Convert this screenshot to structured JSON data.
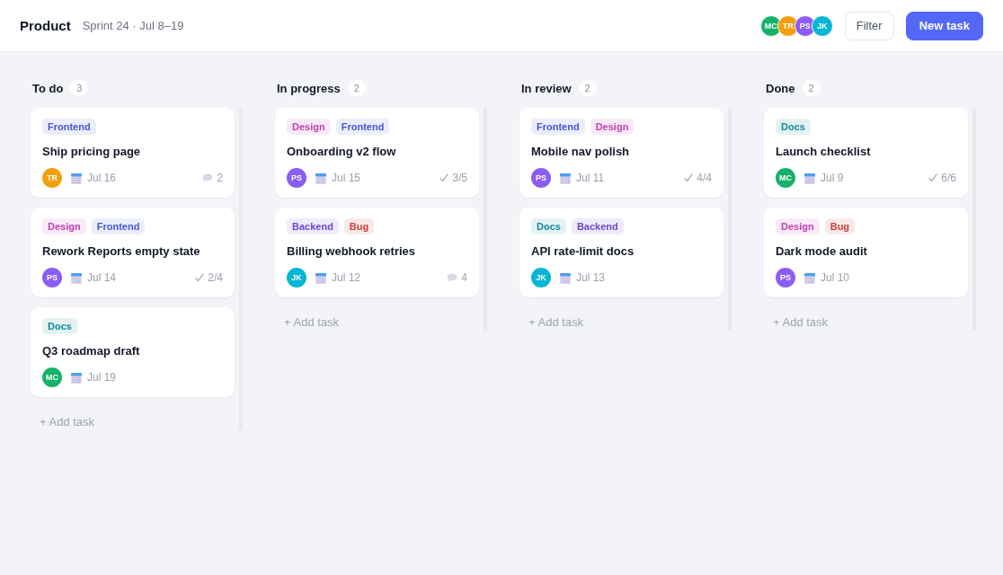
{
  "header": {
    "title": "Product",
    "subtitle": "Sprint 24 · Jul 8–19",
    "members": [
      {
        "initials": "MC",
        "color": "#17b26a"
      },
      {
        "initials": "TR",
        "color": "#f59e0b"
      },
      {
        "initials": "PS",
        "color": "#8b5cf6"
      },
      {
        "initials": "JK",
        "color": "#06b6d4"
      }
    ],
    "buttons": [
      {
        "label": "Filter",
        "kind": "secondary"
      },
      {
        "label": "New task",
        "kind": "primary"
      }
    ]
  },
  "columns": [
    {
      "title": "To do",
      "count": "3",
      "cards": [
        {
          "tags": [
            {
              "label": "Frontend",
              "color": "#4657d6"
            }
          ],
          "title": "Ship pricing page",
          "assignee": {
            "initials": "TR",
            "color": "#f59e0b"
          },
          "due": "Jul 16",
          "meta": {
            "kind": "comments",
            "text": "2"
          }
        },
        {
          "tags": [
            {
              "label": "Design",
              "color": "#c43fb4"
            },
            {
              "label": "Frontend",
              "color": "#4657d6"
            }
          ],
          "title": "Rework Reports empty state",
          "assignee": {
            "initials": "PS",
            "color": "#8b5cf6"
          },
          "due": "Jul 14",
          "meta": {
            "kind": "subtasks",
            "text": "2/4"
          }
        },
        {
          "tags": [
            {
              "label": "Docs",
              "color": "#0e8a9e"
            }
          ],
          "title": "Q3 roadmap draft",
          "assignee": {
            "initials": "MC",
            "color": "#17b26a"
          },
          "due": "Jul 19"
        }
      ],
      "add_label": "+ Add task"
    },
    {
      "title": "In progress",
      "count": "2",
      "cards": [
        {
          "tags": [
            {
              "label": "Design",
              "color": "#c43fb4"
            },
            {
              "label": "Frontend",
              "color": "#4657d6"
            }
          ],
          "title": "Onboarding v2 flow",
          "assignee": {
            "initials": "PS",
            "color": "#8b5cf6"
          },
          "due": "Jul 15",
          "meta": {
            "kind": "subtasks",
            "text": "3/5"
          }
        },
        {
          "tags": [
            {
              "label": "Backend",
              "color": "#6d45cf"
            },
            {
              "label": "Bug",
              "color": "#d13b3b"
            }
          ],
          "title": "Billing webhook retries",
          "assignee": {
            "initials": "JK",
            "color": "#06b6d4"
          },
          "due": "Jul 12",
          "meta": {
            "kind": "comments",
            "text": "4"
          }
        }
      ],
      "add_label": "+ Add task"
    },
    {
      "title": "In review",
      "count": "2",
      "cards": [
        {
          "tags": [
            {
              "label": "Frontend",
              "color": "#4657d6"
            },
            {
              "label": "Design",
              "color": "#c43fb4"
            }
          ],
          "title": "Mobile nav polish",
          "assignee": {
            "initials": "PS",
            "color": "#8b5cf6"
          },
          "due": "Jul 11",
          "meta": {
            "kind": "subtasks",
            "text": "4/4"
          }
        },
        {
          "tags": [
            {
              "label": "Docs",
              "color": "#0e8a9e"
            },
            {
              "label": "Backend",
              "color": "#6d45cf"
            }
          ],
          "title": "API rate-limit docs",
          "assignee": {
            "initials": "JK",
            "color": "#06b6d4"
          },
          "due": "Jul 13"
        }
      ],
      "add_label": "+ Add task"
    },
    {
      "title": "Done",
      "count": "2",
      "cards": [
        {
          "tags": [
            {
              "label": "Docs",
              "color": "#0e8a9e"
            }
          ],
          "title": "Launch checklist",
          "assignee": {
            "initials": "MC",
            "color": "#17b26a"
          },
          "due": "Jul 9",
          "meta": {
            "kind": "subtasks",
            "text": "6/6"
          }
        },
        {
          "tags": [
            {
              "label": "Design",
              "color": "#c43fb4"
            },
            {
              "label": "Bug",
              "color": "#d13b3b"
            }
          ],
          "title": "Dark mode audit",
          "assignee": {
            "initials": "PS",
            "color": "#8b5cf6"
          },
          "due": "Jul 10"
        }
      ],
      "add_label": "+ Add task"
    }
  ]
}
